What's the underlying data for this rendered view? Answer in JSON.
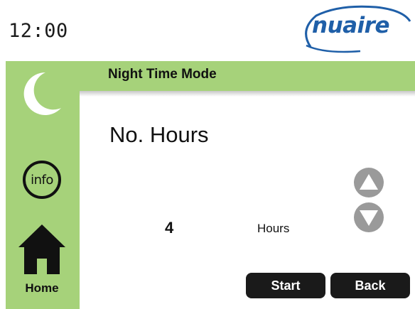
{
  "header": {
    "time": "12:00",
    "logo_text": "nuaire"
  },
  "sidebar": {
    "mode_icon": "moon-icon",
    "info_label": "info",
    "home_icon": "home-icon",
    "home_label": "Home"
  },
  "title_bar": {
    "title": "Night Time Mode"
  },
  "main": {
    "heading": "No. Hours",
    "value": "4",
    "unit": "Hours",
    "up_icon": "arrow-up-icon",
    "down_icon": "arrow-down-icon"
  },
  "actions": {
    "start_label": "Start",
    "back_label": "Back"
  },
  "colors": {
    "accent_green": "#a6d27a",
    "logo_blue": "#1f5fa8",
    "button_dark": "#1a1a1a",
    "arrow_gray": "#9a9a9a"
  }
}
